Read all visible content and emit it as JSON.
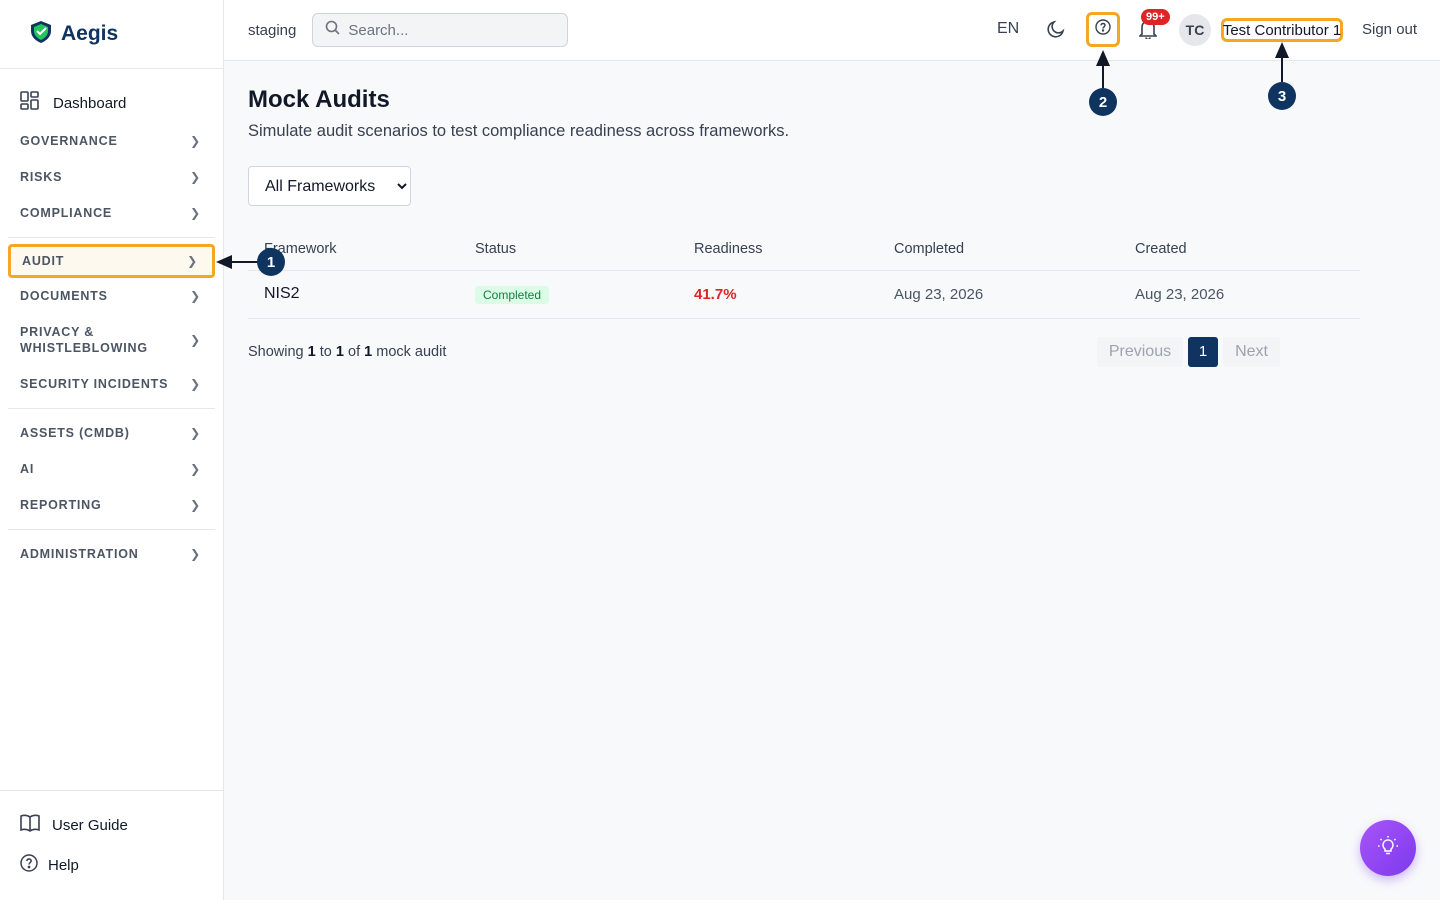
{
  "app": {
    "name": "Aegis"
  },
  "topbar": {
    "environment": "staging",
    "search_placeholder": "Search...",
    "language": "EN",
    "notification_count": "99+",
    "avatar_initials": "TC",
    "user_name": "Test Contributor 1",
    "sign_out": "Sign out"
  },
  "sidebar": {
    "dashboard": "Dashboard",
    "items": [
      "GOVERNANCE",
      "RISKS",
      "COMPLIANCE",
      "AUDIT",
      "DOCUMENTS",
      "PRIVACY & WHISTLEBLOWING",
      "SECURITY INCIDENTS",
      "ASSETS (CMDB)",
      "AI",
      "REPORTING",
      "ADMINISTRATION"
    ],
    "privacy_line1": "PRIVACY &",
    "privacy_line2": "WHISTLEBLOWING",
    "user_guide": "User Guide",
    "help": "Help"
  },
  "main": {
    "title": "Mock Audits",
    "subtitle": "Simulate audit scenarios to test compliance readiness across frameworks.",
    "filter_selected": "All Frameworks",
    "columns": {
      "framework": "Framework",
      "status": "Status",
      "readiness": "Readiness",
      "completed": "Completed",
      "created": "Created"
    },
    "rows": [
      {
        "framework": "NIS2",
        "status": "Completed",
        "readiness": "41.7%",
        "completed": "Aug 23, 2026",
        "created": "Aug 23, 2026"
      }
    ],
    "showing": {
      "prefix": "Showing",
      "from": "1",
      "to_word": "to",
      "to": "1",
      "of_word": "of",
      "total": "1",
      "suffix": "mock audit"
    },
    "pager": {
      "previous": "Previous",
      "page": "1",
      "next": "Next"
    }
  },
  "annotations": {
    "m1": "1",
    "m2": "2",
    "m3": "3"
  },
  "colors": {
    "highlight": "#f5a623",
    "brand": "#0f3460",
    "readiness": "#dc2626"
  }
}
